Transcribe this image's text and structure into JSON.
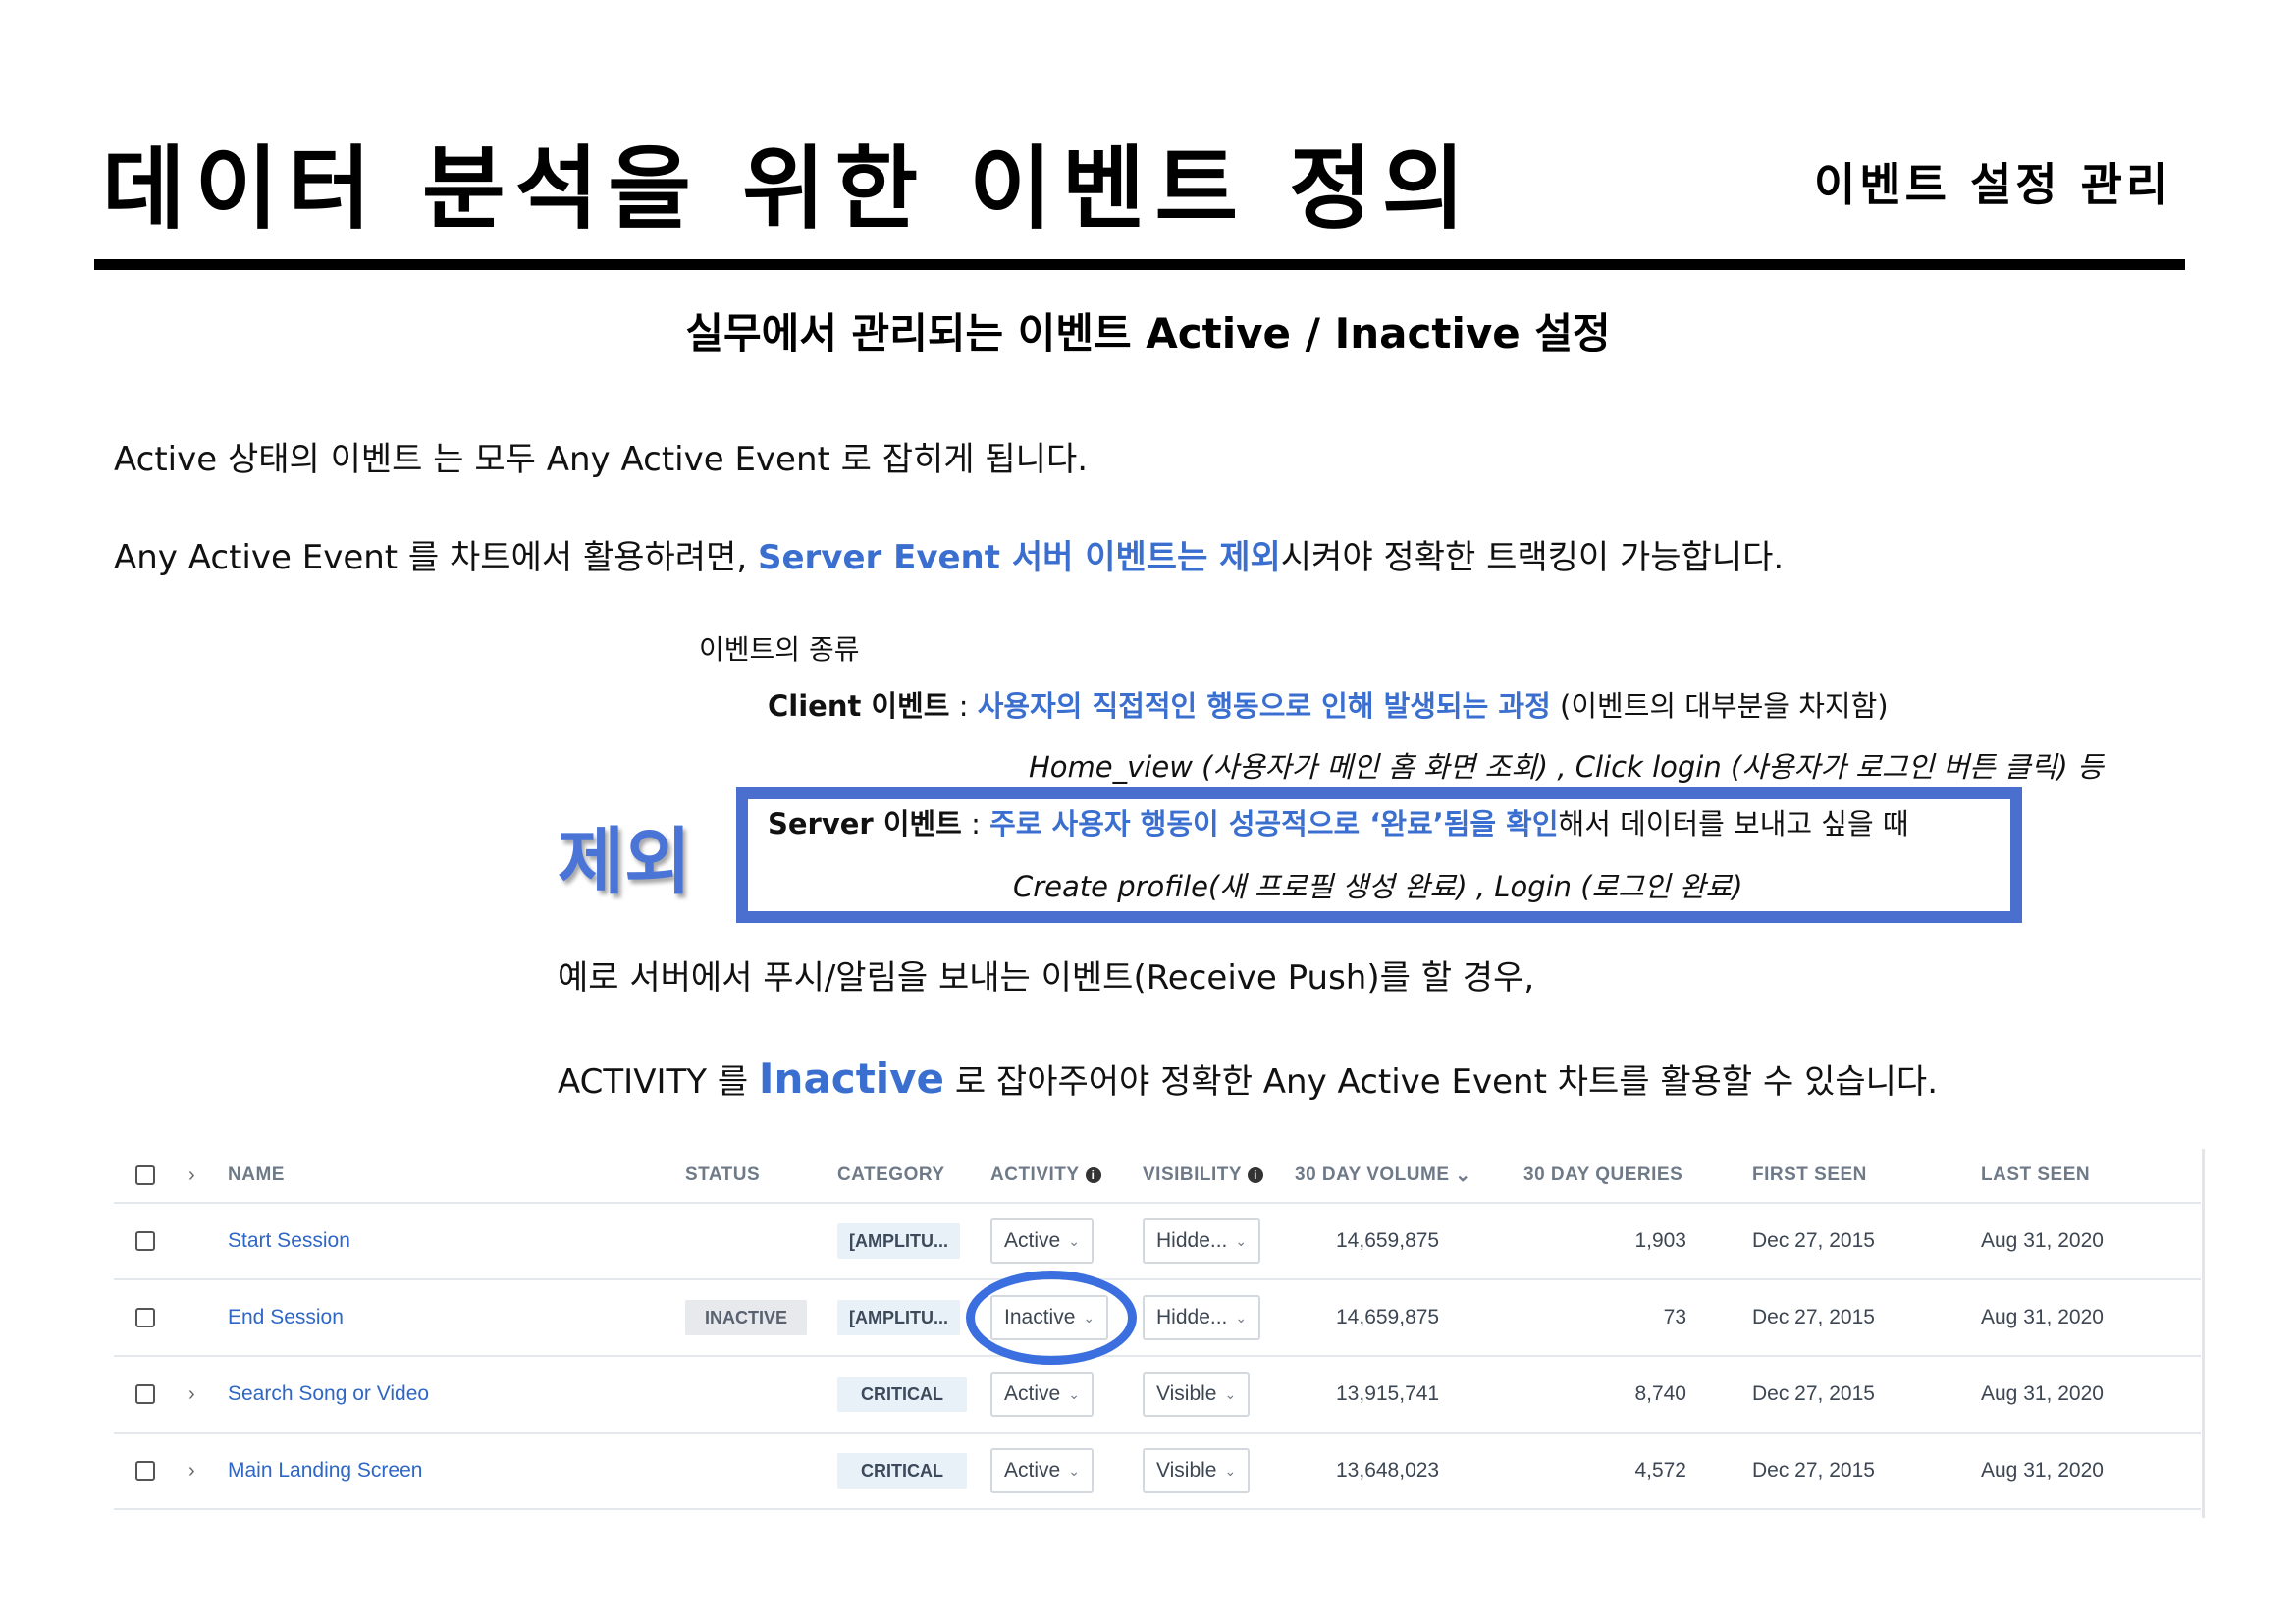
{
  "page": {
    "title": "데이터 분석을 위한 이벤트 정의",
    "corner_title": "이벤트 설정 관리",
    "section_title": "실무에서 관리되는 이벤트 Active / Inactive 설정"
  },
  "intro": {
    "line1": "Active 상태의 이벤트 는 모두 Any Active Event 로 잡히게 됩니다.",
    "line2_pre": "Any Active Event 를 차트에서 활용하려면, ",
    "line2_highlight": "Server Event 서버 이벤트는 제외",
    "line2_post": "시켜야 정확한 트랙킹이 가능합니다."
  },
  "event_types": {
    "label": "이벤트의 종류",
    "client": {
      "name": "Client 이벤트",
      "separator": " : ",
      "desc": "사용자의 직접적인 행동으로 인해 발생되는 과정",
      "note": " (이벤트의 대부분을 차지함)",
      "examples": "Home_view (사용자가 메인 홈 화면 조회) , Click login (사용자가 로그인 버튼 클릭) 등"
    },
    "server": {
      "name": "Server 이벤트",
      "separator": " : ",
      "desc": "주로 사용자 행동이 성공적으로 ‘완료’됨을 확인",
      "note": "해서 데이터를 보내고 싶을 때",
      "examples": "Create profile(새 프로필 생성 완료) , Login (로그인 완료)"
    },
    "exclude_label": "제외"
  },
  "example": {
    "line1": "예로 서버에서 푸시/알림을 보내는 이벤트(Receive Push)를 할 경우,",
    "line2_pre": "ACTIVITY 를 ",
    "line2_highlight": "Inactive",
    "line2_post": " 로 잡아주어야 정확한 Any Active Event 차트를 활용할 수 있습니다."
  },
  "table": {
    "headers": {
      "expand": "›",
      "name": "NAME",
      "status": "STATUS",
      "category": "CATEGORY",
      "activity": "ACTIVITY",
      "visibility": "VISIBILITY",
      "volume": "30 DAY VOLUME",
      "volume_sort": "⌄",
      "queries": "30 DAY QUERIES",
      "first_seen": "FIRST SEEN",
      "last_seen": "LAST SEEN",
      "info_glyph": "i"
    },
    "rows": [
      {
        "expand": "",
        "name": "Start Session",
        "status": "",
        "category": "[AMPLITU...",
        "activity": "Active",
        "visibility": "Hidde...",
        "volume": "14,659,875",
        "queries": "1,903",
        "first_seen": "Dec 27, 2015",
        "last_seen": "Aug 31, 2020"
      },
      {
        "expand": "",
        "name": "End Session",
        "status": "INACTIVE",
        "category": "[AMPLITU...",
        "activity": "Inactive",
        "visibility": "Hidde...",
        "volume": "14,659,875",
        "queries": "73",
        "first_seen": "Dec 27, 2015",
        "last_seen": "Aug 31, 2020"
      },
      {
        "expand": "›",
        "name": "Search Song or Video",
        "status": "",
        "category": "CRITICAL",
        "activity": "Active",
        "visibility": "Visible",
        "volume": "13,915,741",
        "queries": "8,740",
        "first_seen": "Dec 27, 2015",
        "last_seen": "Aug 31, 2020"
      },
      {
        "expand": "›",
        "name": "Main Landing Screen",
        "status": "",
        "category": "CRITICAL",
        "activity": "Active",
        "visibility": "Visible",
        "volume": "13,648,023",
        "queries": "4,572",
        "first_seen": "Dec 27, 2015",
        "last_seen": "Aug 31, 2020"
      }
    ],
    "caret": "⌄"
  },
  "colors": {
    "accent_blue": "#3a6fd0",
    "highlight_box": "#4a6fcf",
    "highlight_circle": "#3b6fe0",
    "link_blue": "#2f67c6"
  }
}
